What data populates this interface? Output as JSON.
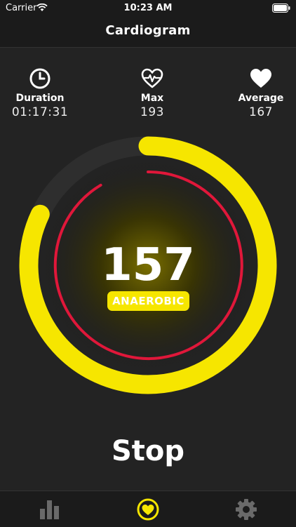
{
  "status_bar": {
    "carrier": "Carrier",
    "time": "10:23 AM"
  },
  "nav": {
    "title": "Cardiogram"
  },
  "stats": [
    {
      "icon": "clock-icon",
      "label": "Duration",
      "value": "01:17:31"
    },
    {
      "icon": "heart-pulse-icon",
      "label": "Max",
      "value": "193"
    },
    {
      "icon": "heart-icon",
      "label": "Average",
      "value": "167"
    }
  ],
  "heart_rate": {
    "bpm": "157",
    "zone": "ANAEROBIC",
    "progress_fraction": 0.82
  },
  "actions": {
    "stop_label": "Stop"
  },
  "tabs": [
    {
      "icon": "bar-chart-icon",
      "active": false
    },
    {
      "icon": "heart-icon",
      "active": true
    },
    {
      "icon": "gear-icon",
      "active": false
    }
  ],
  "colors": {
    "accent": "#f6e600",
    "zone_ring": "#e0173a",
    "background": "#232323"
  }
}
